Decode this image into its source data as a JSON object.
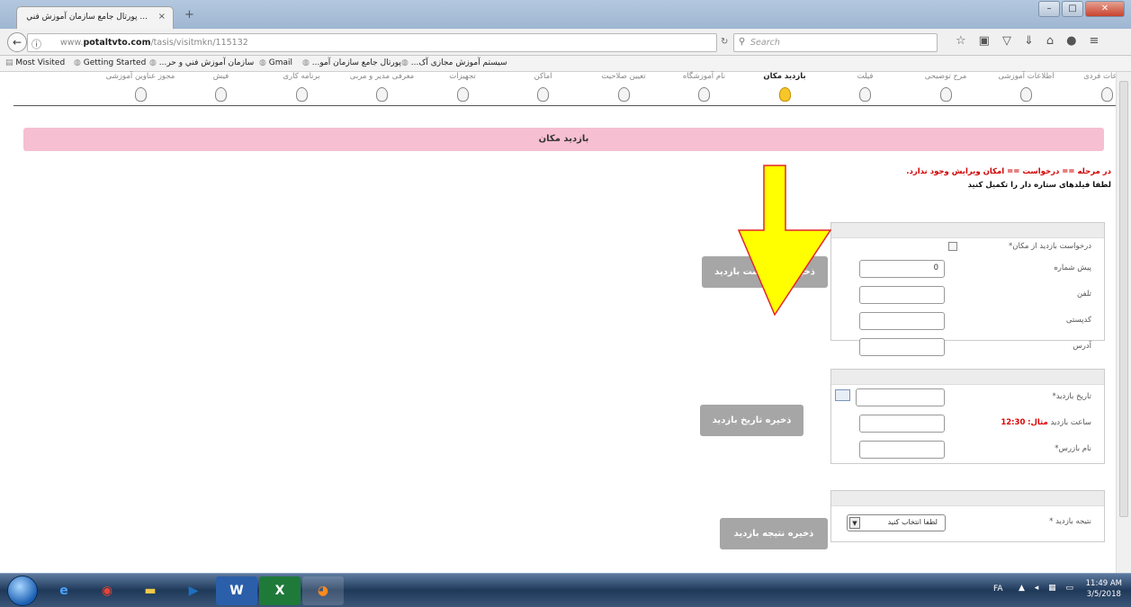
{
  "browser": {
    "tab_title": "... پورتال جامع سازمان آموزش فني",
    "tab_close": "×",
    "new_tab": "+",
    "url_prefix": "www.",
    "url_domain": "potaltvto.com",
    "url_path": "/tasis/visitmkn/115132",
    "search_placeholder": "Search"
  },
  "bookmarks": [
    {
      "label": "Most Visited"
    },
    {
      "label": "Getting Started"
    },
    {
      "label": "...سازمان آموزش فني و حر"
    },
    {
      "label": "Gmail"
    },
    {
      "label": "...پورتال جامع سازمان آمو"
    },
    {
      "label": "...سیستم آموزش مجازی آک"
    }
  ],
  "steps": [
    {
      "label": "اطلاعات فردی",
      "active": false
    },
    {
      "label": "اطلاعات آموزشی",
      "active": false
    },
    {
      "label": "مرح توضیحی",
      "active": false
    },
    {
      "label": "فیلت",
      "active": false
    },
    {
      "label": "بازدید مکان",
      "active": true
    },
    {
      "label": "نام آموزشگاه",
      "active": false
    },
    {
      "label": "تعیین صلاحیت",
      "active": false
    },
    {
      "label": "اماکن",
      "active": false
    },
    {
      "label": "تجهیزات",
      "active": false
    },
    {
      "label": "معرفی مدیر و مربی",
      "active": false
    },
    {
      "label": "برنامه کاری",
      "active": false
    },
    {
      "label": "فیش",
      "active": false
    },
    {
      "label": "مجوز عناوین آموزشی",
      "active": false
    }
  ],
  "page": {
    "title": "بازدید مکان",
    "error_message": "در مرحله == درخواست == امکان ویرایش وجود ندارد.",
    "instruction": "لطفا فیلدهای ستاره دار را تکمیل کنید"
  },
  "form1": {
    "request_label": "درخواست بازدید از مکان*",
    "prefix_label": "پیش شماره",
    "prefix_value": "0",
    "phone_label": "تلفن",
    "postal_label": "کدپستی",
    "address_label": "آدرس",
    "save_button": "ذخیره درخواست بازدید"
  },
  "form2": {
    "date_label": "تاریخ بازدید*",
    "time_label": "ساعت بازدید",
    "time_example_prefix": "مثال:",
    "time_example_value": "12:30",
    "inspector_label": "نام بازرس*",
    "save_button": "ذخیره تاریخ بازدید"
  },
  "form3": {
    "result_label": "نتیجه بازدید *",
    "result_selected": "لطفا انتخاب کنید",
    "save_button": "ذخیره نتیجه بازدید"
  },
  "taskbar": {
    "lang": "FA",
    "time": "11:49 AM",
    "date": "3/5/2018"
  },
  "colors": {
    "title_bar": "#f6bfd2",
    "arrow_fill": "#ffff00",
    "arrow_stroke": "#e3262b",
    "error_text": "#d10000",
    "button_gray": "#a6a6a6"
  }
}
